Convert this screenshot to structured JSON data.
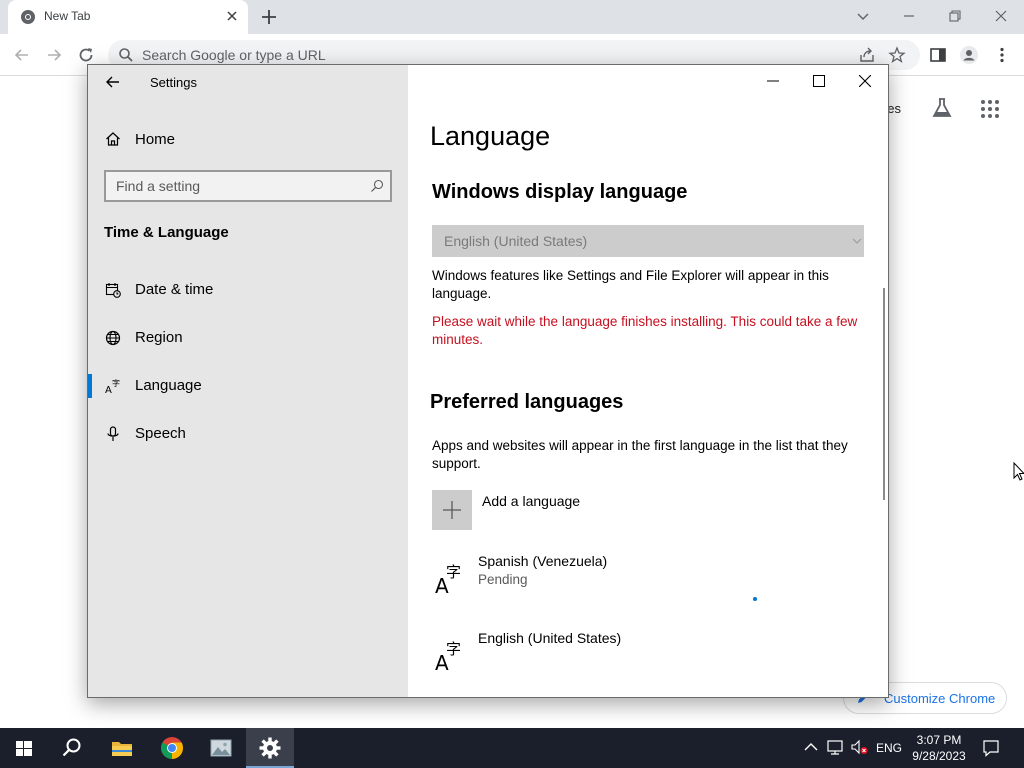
{
  "browser": {
    "tab_title": "New Tab",
    "omnibox_placeholder": "Search Google or type a URL",
    "ntp_partial_text": "ges",
    "customize_label": "Customize Chrome",
    "icons": [
      "chrome-favicon",
      "close-icon",
      "plus-icon",
      "chevron-down-icon",
      "minimize-icon",
      "restore-icon",
      "back-arrow-icon",
      "forward-arrow-icon",
      "reload-icon",
      "search-icon",
      "share-icon",
      "star-icon",
      "side-panel-icon",
      "profile-icon",
      "more-vert-icon",
      "labs-flask-icon",
      "apps-grid-icon",
      "pencil-icon"
    ]
  },
  "settings": {
    "window_title": "Settings",
    "sidebar": {
      "home_label": "Home",
      "search_placeholder": "Find a setting",
      "section_heading": "Time & Language",
      "items": [
        {
          "label": "Date & time",
          "icon": "calendar-clock-icon"
        },
        {
          "label": "Region",
          "icon": "globe-icon"
        },
        {
          "label": "Language",
          "icon": "language-icon",
          "selected": true
        },
        {
          "label": "Speech",
          "icon": "microphone-icon"
        }
      ]
    },
    "main": {
      "title": "Language",
      "display_language_heading": "Windows display language",
      "display_language_value": "English (United States)",
      "display_language_desc": "Windows features like Settings and File Explorer will appear in this language.",
      "install_warning": "Please wait while the language finishes installing. This could take a few minutes.",
      "preferred_heading": "Preferred languages",
      "preferred_desc": "Apps and websites will appear in the first language in the list that they support.",
      "add_language_label": "Add a language",
      "languages": [
        {
          "name": "Spanish (Venezuela)",
          "status": "Pending"
        },
        {
          "name": "English (United States)",
          "status": ""
        }
      ]
    },
    "accent_color": "#0078d7",
    "error_color": "#c50f1f"
  },
  "taskbar": {
    "apps": [
      "windows-start-icon",
      "search-icon",
      "file-explorer-icon",
      "chrome-icon",
      "photos-icon",
      "settings-gear-icon"
    ],
    "input_language": "ENG",
    "time": "3:07 PM",
    "date": "9/28/2023"
  }
}
